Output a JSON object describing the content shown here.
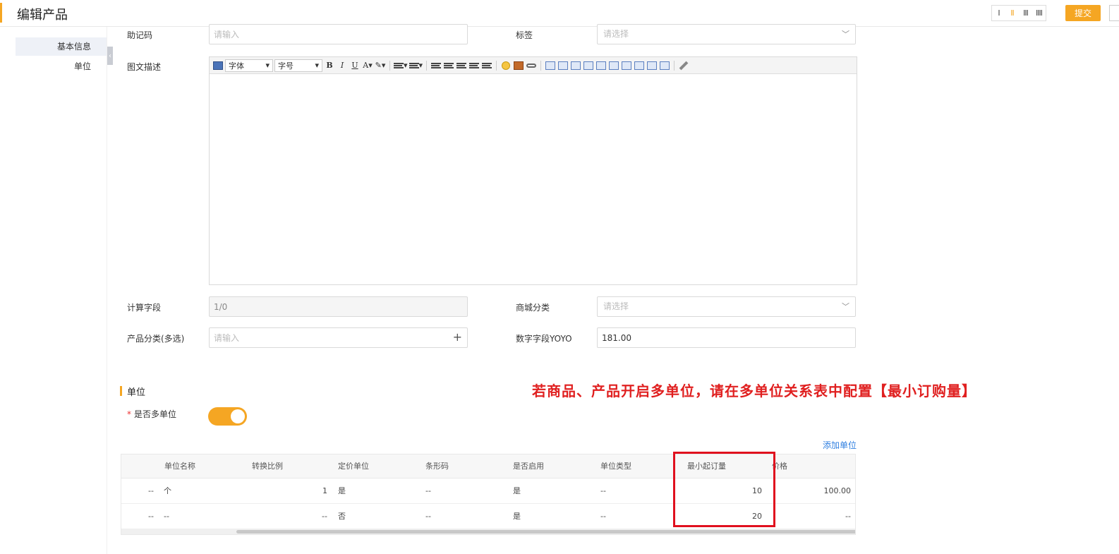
{
  "header": {
    "title": "编辑产品",
    "layout_options": [
      "I",
      "II",
      "III",
      "IIII"
    ],
    "submit_label": "提交"
  },
  "leftnav": {
    "items": [
      {
        "label": "基本信息"
      },
      {
        "label": "单位"
      }
    ]
  },
  "form": {
    "mnemonic": {
      "label": "助记码",
      "placeholder": "请输入"
    },
    "tag": {
      "label": "标签",
      "placeholder": "请选择"
    },
    "description": {
      "label": "图文描述"
    },
    "calc_field": {
      "label": "计算字段",
      "value": "1/0"
    },
    "mall_category": {
      "label": "商城分类",
      "placeholder": "请选择"
    },
    "product_category": {
      "label": "产品分类(多选)",
      "placeholder": "请输入"
    },
    "number_field": {
      "label": "数字字段YOYO",
      "value": "181.00"
    }
  },
  "editor": {
    "font_label": "字体",
    "size_label": "字号",
    "bold": "B",
    "italic": "I",
    "underline": "U",
    "font_color": "A"
  },
  "unit_section": {
    "title": "单位",
    "multi_unit_label": "是否多单位",
    "multi_unit_enabled": true,
    "add_unit_label": "添加单位",
    "annotation": "若商品、产品开启多单位，请在多单位关系表中配置【最小订购量】"
  },
  "table": {
    "columns": [
      "单位名称",
      "转换比例",
      "定价单位",
      "条形码",
      "是否启用",
      "单位类型",
      "最小起订量",
      "价格"
    ],
    "rows": [
      {
        "lead": "--",
        "name": "个",
        "ratio": "1",
        "pricing": "是",
        "barcode": "--",
        "enabled": "是",
        "type": "--",
        "min_qty": "10",
        "price": "100.00"
      },
      {
        "lead": "--",
        "name": "--",
        "ratio": "--",
        "pricing": "否",
        "barcode": "--",
        "enabled": "是",
        "type": "--",
        "min_qty": "20",
        "price": "--"
      }
    ]
  },
  "colors": {
    "accent": "#f5a623",
    "annotation": "#e02020",
    "link": "#2f7fe0"
  }
}
